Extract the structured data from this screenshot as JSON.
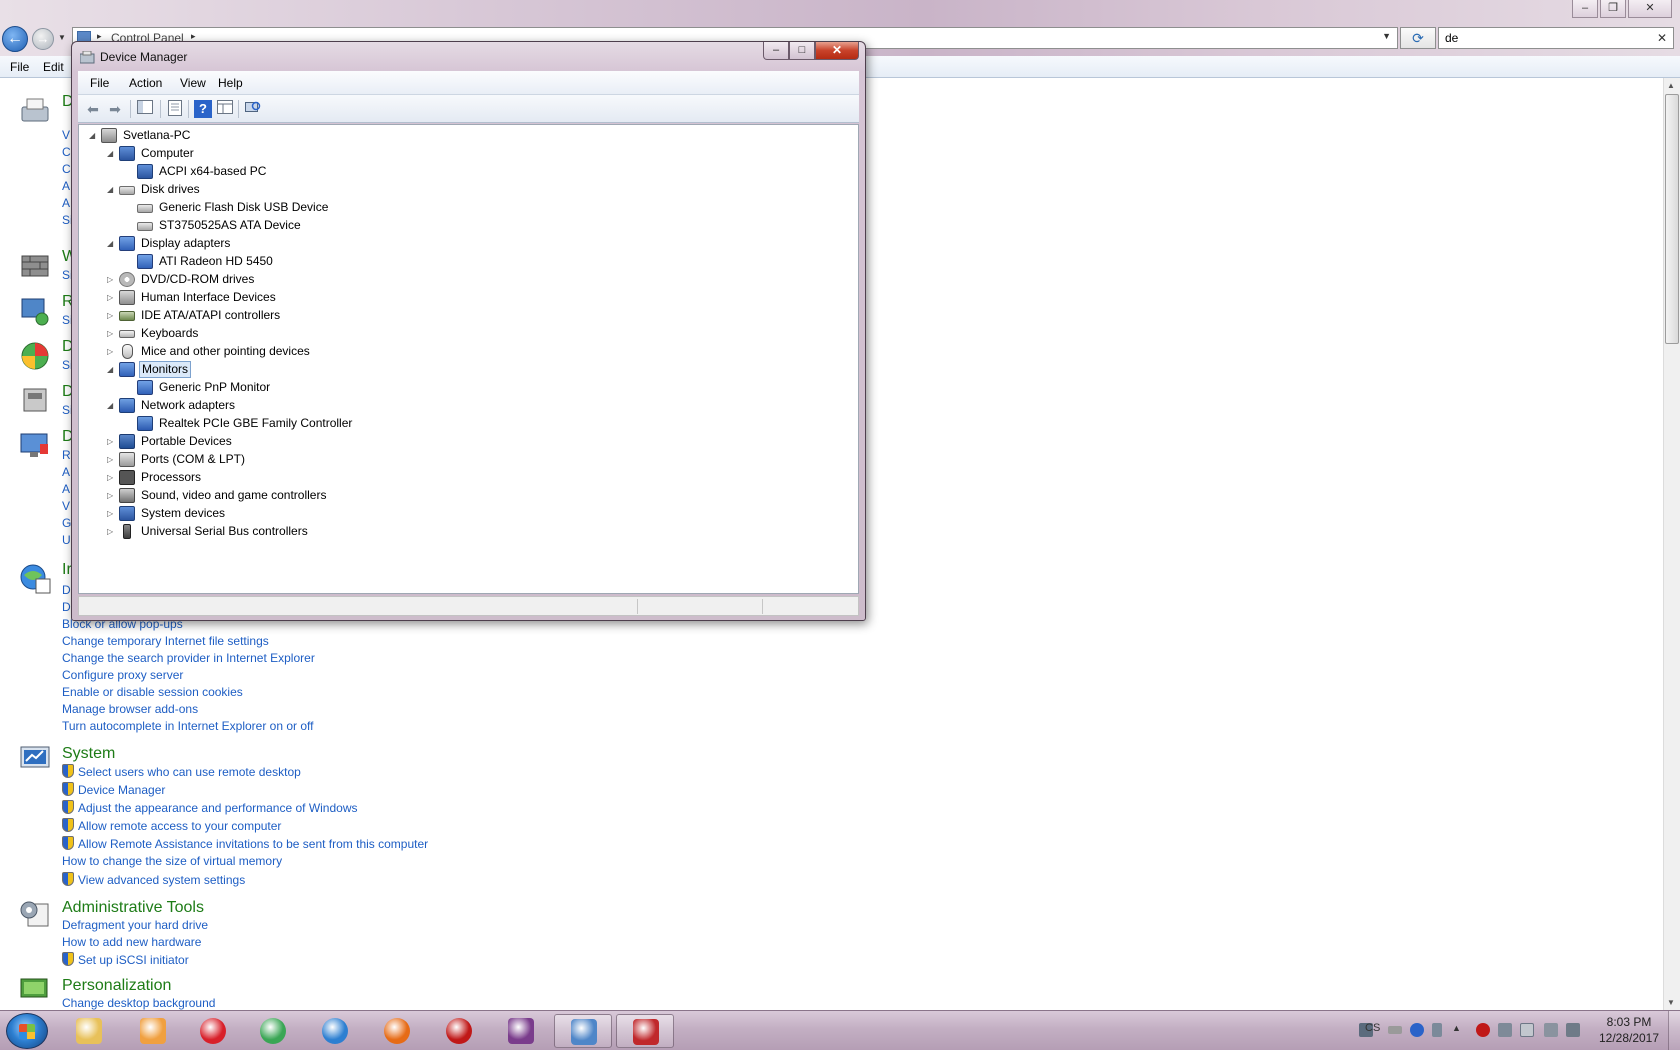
{
  "control_panel": {
    "breadcrumb": [
      "Control Panel"
    ],
    "search_value": "de",
    "menu": [
      "File",
      "Edit"
    ],
    "partial_categories": [
      "D",
      "W",
      "R",
      "D",
      "D",
      "D",
      "Ir"
    ],
    "partial_links": [
      "V",
      "C",
      "C",
      "A",
      "A",
      "Si",
      "Si",
      "Si",
      "Si",
      "Si",
      "R",
      "A",
      "A",
      "V",
      "G",
      "U",
      "D",
      "D"
    ],
    "internet_links": [
      "Block or allow pop-ups",
      "Change temporary Internet file settings",
      "Change the search provider in Internet Explorer",
      "Configure proxy server",
      "Enable or disable session cookies",
      "Manage browser add-ons",
      "Turn autocomplete in Internet Explorer on or off"
    ],
    "system": {
      "title": "System",
      "links": [
        {
          "text": "Select users who can use remote desktop",
          "shield": true
        },
        {
          "text": "Device Manager",
          "shield": true
        },
        {
          "text": "Adjust the appearance and performance of Windows",
          "shield": true
        },
        {
          "text": "Allow remote access to your computer",
          "shield": true
        },
        {
          "text": "Allow Remote Assistance invitations to be sent from this computer",
          "shield": true
        },
        {
          "text": "How to change the size of virtual memory",
          "shield": false
        },
        {
          "text": "View advanced system settings",
          "shield": true
        }
      ]
    },
    "admin_tools": {
      "title": "Administrative Tools",
      "links": [
        {
          "text": "Defragment your hard drive",
          "shield": false
        },
        {
          "text": "How to add new hardware",
          "shield": false
        },
        {
          "text": "Set up iSCSI initiator",
          "shield": true
        }
      ]
    },
    "personalization": {
      "title": "Personalization",
      "links": [
        "Change desktop background"
      ]
    }
  },
  "device_manager": {
    "title": "Device Manager",
    "menu": [
      "File",
      "Action",
      "View",
      "Help"
    ],
    "toolbar": [
      "back-icon",
      "forward-icon",
      "show-hide-console-tree-icon",
      "properties-icon",
      "help-icon",
      "view-icon",
      "scan-hardware-icon"
    ],
    "tree": [
      {
        "label": "Svetlana-PC",
        "level": 0,
        "expanded": true,
        "icon": "pc"
      },
      {
        "label": "Computer",
        "level": 1,
        "expanded": true,
        "icon": "comp"
      },
      {
        "label": "ACPI x64-based PC",
        "level": 2,
        "icon": "comp"
      },
      {
        "label": "Disk drives",
        "level": 1,
        "expanded": true,
        "icon": "disk"
      },
      {
        "label": "Generic Flash Disk USB Device",
        "level": 2,
        "icon": "disk"
      },
      {
        "label": "ST3750525AS ATA Device",
        "level": 2,
        "icon": "disk"
      },
      {
        "label": "Display adapters",
        "level": 1,
        "expanded": true,
        "icon": "mon"
      },
      {
        "label": "ATI Radeon HD 5450",
        "level": 2,
        "icon": "mon"
      },
      {
        "label": "DVD/CD-ROM drives",
        "level": 1,
        "expanded": false,
        "icon": "dvd"
      },
      {
        "label": "Human Interface Devices",
        "level": 1,
        "expanded": false,
        "icon": "hid"
      },
      {
        "label": "IDE ATA/ATAPI controllers",
        "level": 1,
        "expanded": false,
        "icon": "ide"
      },
      {
        "label": "Keyboards",
        "level": 1,
        "expanded": false,
        "icon": "kbd"
      },
      {
        "label": "Mice and other pointing devices",
        "level": 1,
        "expanded": false,
        "icon": "mouse"
      },
      {
        "label": "Monitors",
        "level": 1,
        "expanded": true,
        "icon": "mon",
        "selected": true
      },
      {
        "label": "Generic PnP Monitor",
        "level": 2,
        "icon": "mon"
      },
      {
        "label": "Network adapters",
        "level": 1,
        "expanded": true,
        "icon": "net"
      },
      {
        "label": "Realtek PCIe GBE Family Controller",
        "level": 2,
        "icon": "net"
      },
      {
        "label": "Portable Devices",
        "level": 1,
        "expanded": false,
        "icon": "port2"
      },
      {
        "label": "Ports (COM & LPT)",
        "level": 1,
        "expanded": false,
        "icon": "port"
      },
      {
        "label": "Processors",
        "level": 1,
        "expanded": false,
        "icon": "proc"
      },
      {
        "label": "Sound, video and game controllers",
        "level": 1,
        "expanded": false,
        "icon": "snd"
      },
      {
        "label": "System devices",
        "level": 1,
        "expanded": false,
        "icon": "comp"
      },
      {
        "label": "Universal Serial Bus controllers",
        "level": 1,
        "expanded": false,
        "icon": "usb"
      }
    ]
  },
  "taskbar": {
    "apps": [
      {
        "name": "windows-explorer-icon",
        "color": "#e8c15a"
      },
      {
        "name": "media-player-icon",
        "color": "#f0a040"
      },
      {
        "name": "opera-icon",
        "color": "#d8202a"
      },
      {
        "name": "chrome-icon",
        "color": "#3aa655"
      },
      {
        "name": "chrome-beta-icon",
        "color": "#2d7fd1"
      },
      {
        "name": "firefox-icon",
        "color": "#e66b16"
      },
      {
        "name": "game-app-icon",
        "color": "#c01818"
      },
      {
        "name": "winrar-icon",
        "color": "#7a3c8c"
      },
      {
        "name": "control-panel-icon",
        "color": "#4f86c8",
        "active": true
      },
      {
        "name": "device-toolbox-icon",
        "color": "#c0282c",
        "active": true
      }
    ],
    "language": "CS",
    "time": "8:03 PM",
    "date": "12/28/2017"
  }
}
